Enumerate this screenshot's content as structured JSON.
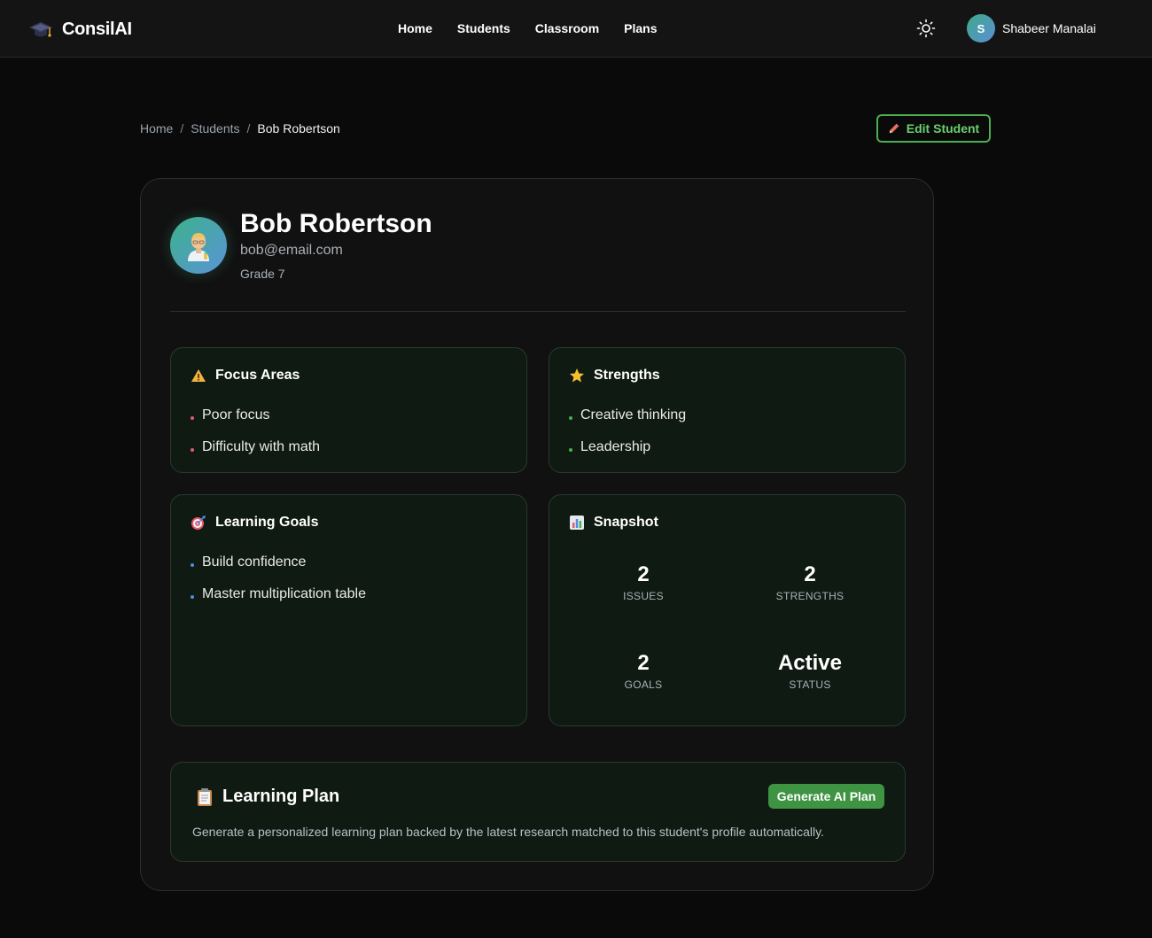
{
  "brand": {
    "name": "ConsilAI",
    "icon": "graduation-cap-icon"
  },
  "nav": {
    "links": [
      "Home",
      "Students",
      "Classroom",
      "Plans"
    ]
  },
  "user": {
    "initial": "S",
    "name": "Shabeer Manalai"
  },
  "breadcrumb": {
    "home": "Home",
    "sep": "/",
    "students": "Students",
    "current": "Bob Robertson"
  },
  "actions": {
    "edit_label": "Edit Student"
  },
  "student": {
    "name": "Bob Robertson",
    "email": "bob@email.com",
    "grade": "Grade 7",
    "avatar_icon": "student-avatar-icon"
  },
  "focus_areas": {
    "title": "Focus Areas",
    "icon": "warning-icon",
    "items": [
      "Poor focus",
      "Difficulty with math"
    ],
    "dot_color": "#e05d6f"
  },
  "strengths": {
    "title": "Strengths",
    "icon": "star-icon",
    "items": [
      "Creative thinking",
      "Leadership"
    ],
    "dot_color": "#4caf50"
  },
  "learning_goals": {
    "title": "Learning Goals",
    "icon": "target-icon",
    "items": [
      "Build confidence",
      "Master multiplication table"
    ],
    "dot_color": "#4a8fe7"
  },
  "snapshot": {
    "title": "Snapshot",
    "icon": "bar-chart-icon",
    "stats": [
      {
        "value": "2",
        "label": "ISSUES"
      },
      {
        "value": "2",
        "label": "STRENGTHS"
      },
      {
        "value": "2",
        "label": "GOALS"
      },
      {
        "value": "Active",
        "label": "STATUS"
      }
    ]
  },
  "learning_plan": {
    "title": "Learning Plan",
    "icon": "clipboard-icon",
    "button_label": "Generate AI Plan",
    "description": "Generate a personalized learning plan backed by the latest research matched to this student's profile automatically."
  },
  "colors": {
    "accent": "#4caf50",
    "background": "#0a0a0a",
    "panel": "#0f1a12"
  }
}
